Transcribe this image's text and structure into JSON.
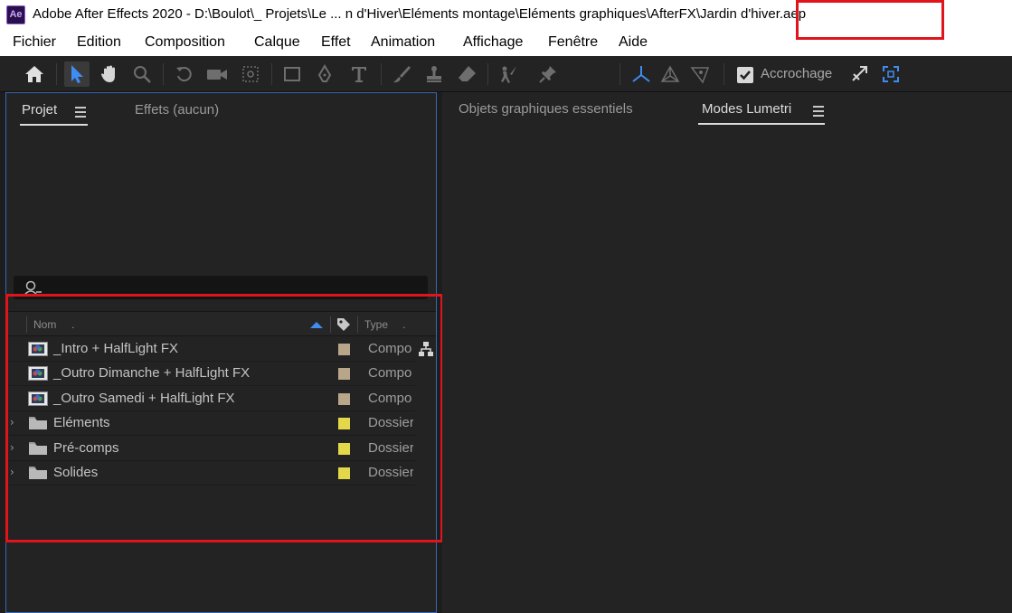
{
  "app": {
    "icon_text": "Ae",
    "title_prefix": "Adobe After Effects 2020 - D:\\Boulot\\_ Projets\\Le ... n d'Hiver\\Eléments montage\\Eléments graphiques\\AfterFX",
    "title_file": "\\Jardin d'hiver.aep"
  },
  "menu": [
    "Fichier",
    "Edition",
    "Composition",
    "Calque",
    "Effet",
    "Animation",
    "Affichage",
    "Fenêtre",
    "Aide"
  ],
  "toolbar": {
    "snap_label": "Accrochage",
    "tools": [
      "home-icon",
      "selection-tool-icon",
      "hand-tool-icon",
      "zoom-tool-icon",
      "rotation-tool-icon",
      "camera-tool-icon",
      "pan-behind-tool-icon",
      "rectangle-tool-icon",
      "pen-tool-icon",
      "type-tool-icon",
      "brush-tool-icon",
      "clone-stamp-tool-icon",
      "eraser-tool-icon",
      "roto-brush-tool-icon",
      "puppet-pin-tool-icon",
      "local-axis-icon",
      "world-axis-icon",
      "view-axis-icon"
    ]
  },
  "project_panel": {
    "tab_project": "Projet",
    "tab_effects": "Effets  (aucun)",
    "columns": {
      "name": "Nom",
      "type": "Type"
    },
    "items": [
      {
        "name": "_Intro + HalfLight FX",
        "type": "Compo",
        "kind": "comp",
        "label_color": "#b8a58a"
      },
      {
        "name": "_Outro Dimanche + HalfLight FX",
        "type": "Compo",
        "kind": "comp",
        "label_color": "#b8a58a"
      },
      {
        "name": "_Outro Samedi + HalfLight FX",
        "type": "Compo",
        "kind": "comp",
        "label_color": "#b8a58a"
      },
      {
        "name": "Eléments",
        "type": "Dossier",
        "kind": "folder",
        "label_color": "#e3d84a"
      },
      {
        "name": "Pré-comps",
        "type": "Dossier",
        "kind": "folder",
        "label_color": "#e3d84a"
      },
      {
        "name": "Solides",
        "type": "Dossier",
        "kind": "folder",
        "label_color": "#e3d84a"
      }
    ]
  },
  "right_panel": {
    "tab_essential_graphics": "Objets graphiques essentiels",
    "tab_lumetri": "Modes Lumetri"
  },
  "colors": {
    "highlight": "#e0141b",
    "accent": "#3567b8",
    "panel_bg": "#232323"
  }
}
